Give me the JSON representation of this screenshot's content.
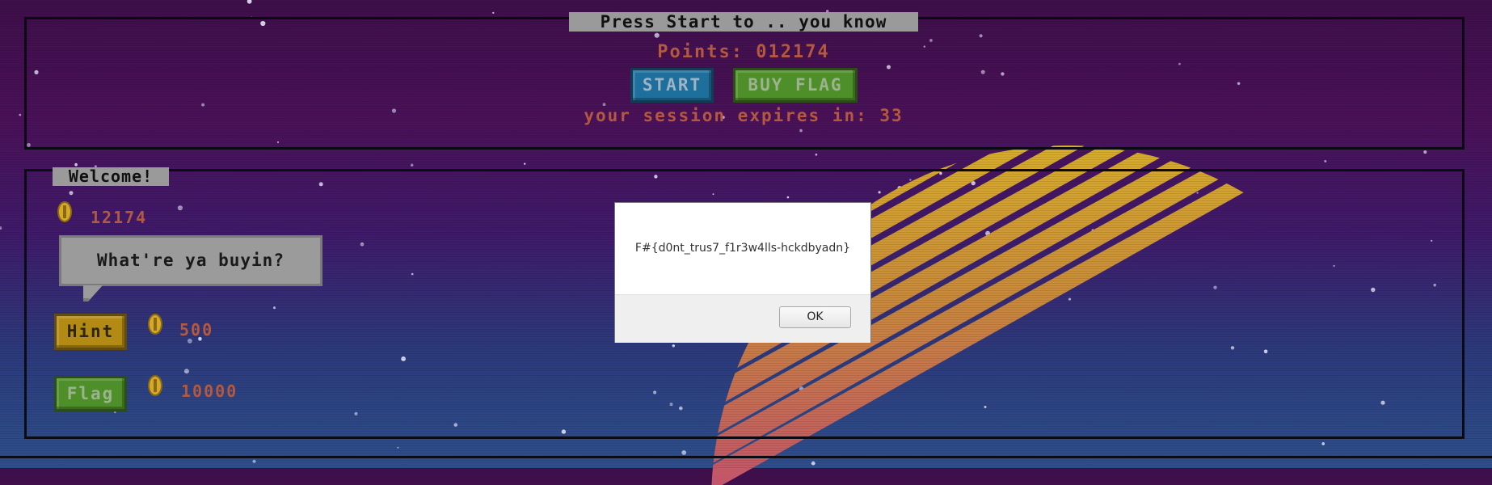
{
  "header": {
    "title": "Press Start to .. you know",
    "points_label": "Points: 012174",
    "start_label": "START",
    "buy_flag_label": "BUY FLAG",
    "session_text": "your session expires in: 33"
  },
  "shop": {
    "welcome": "Welcome!",
    "balance": "12174",
    "speech": "What're ya buyin?",
    "items": [
      {
        "label": "Hint",
        "price": "500"
      },
      {
        "label": "Flag",
        "price": "10000"
      }
    ]
  },
  "alert": {
    "message": "F#{d0nt_trus7_f1r3w4lls-hckdbyadn}",
    "ok_label": "OK"
  },
  "colors": {
    "text_retro": "#b3593f",
    "start": "#1e6f9c",
    "flag": "#4f8f2a",
    "hint": "#b38a14",
    "sun_top": "#d9b12a",
    "sun_bottom": "#c2506e"
  },
  "icons": {
    "coin": "gold-coin-icon"
  }
}
